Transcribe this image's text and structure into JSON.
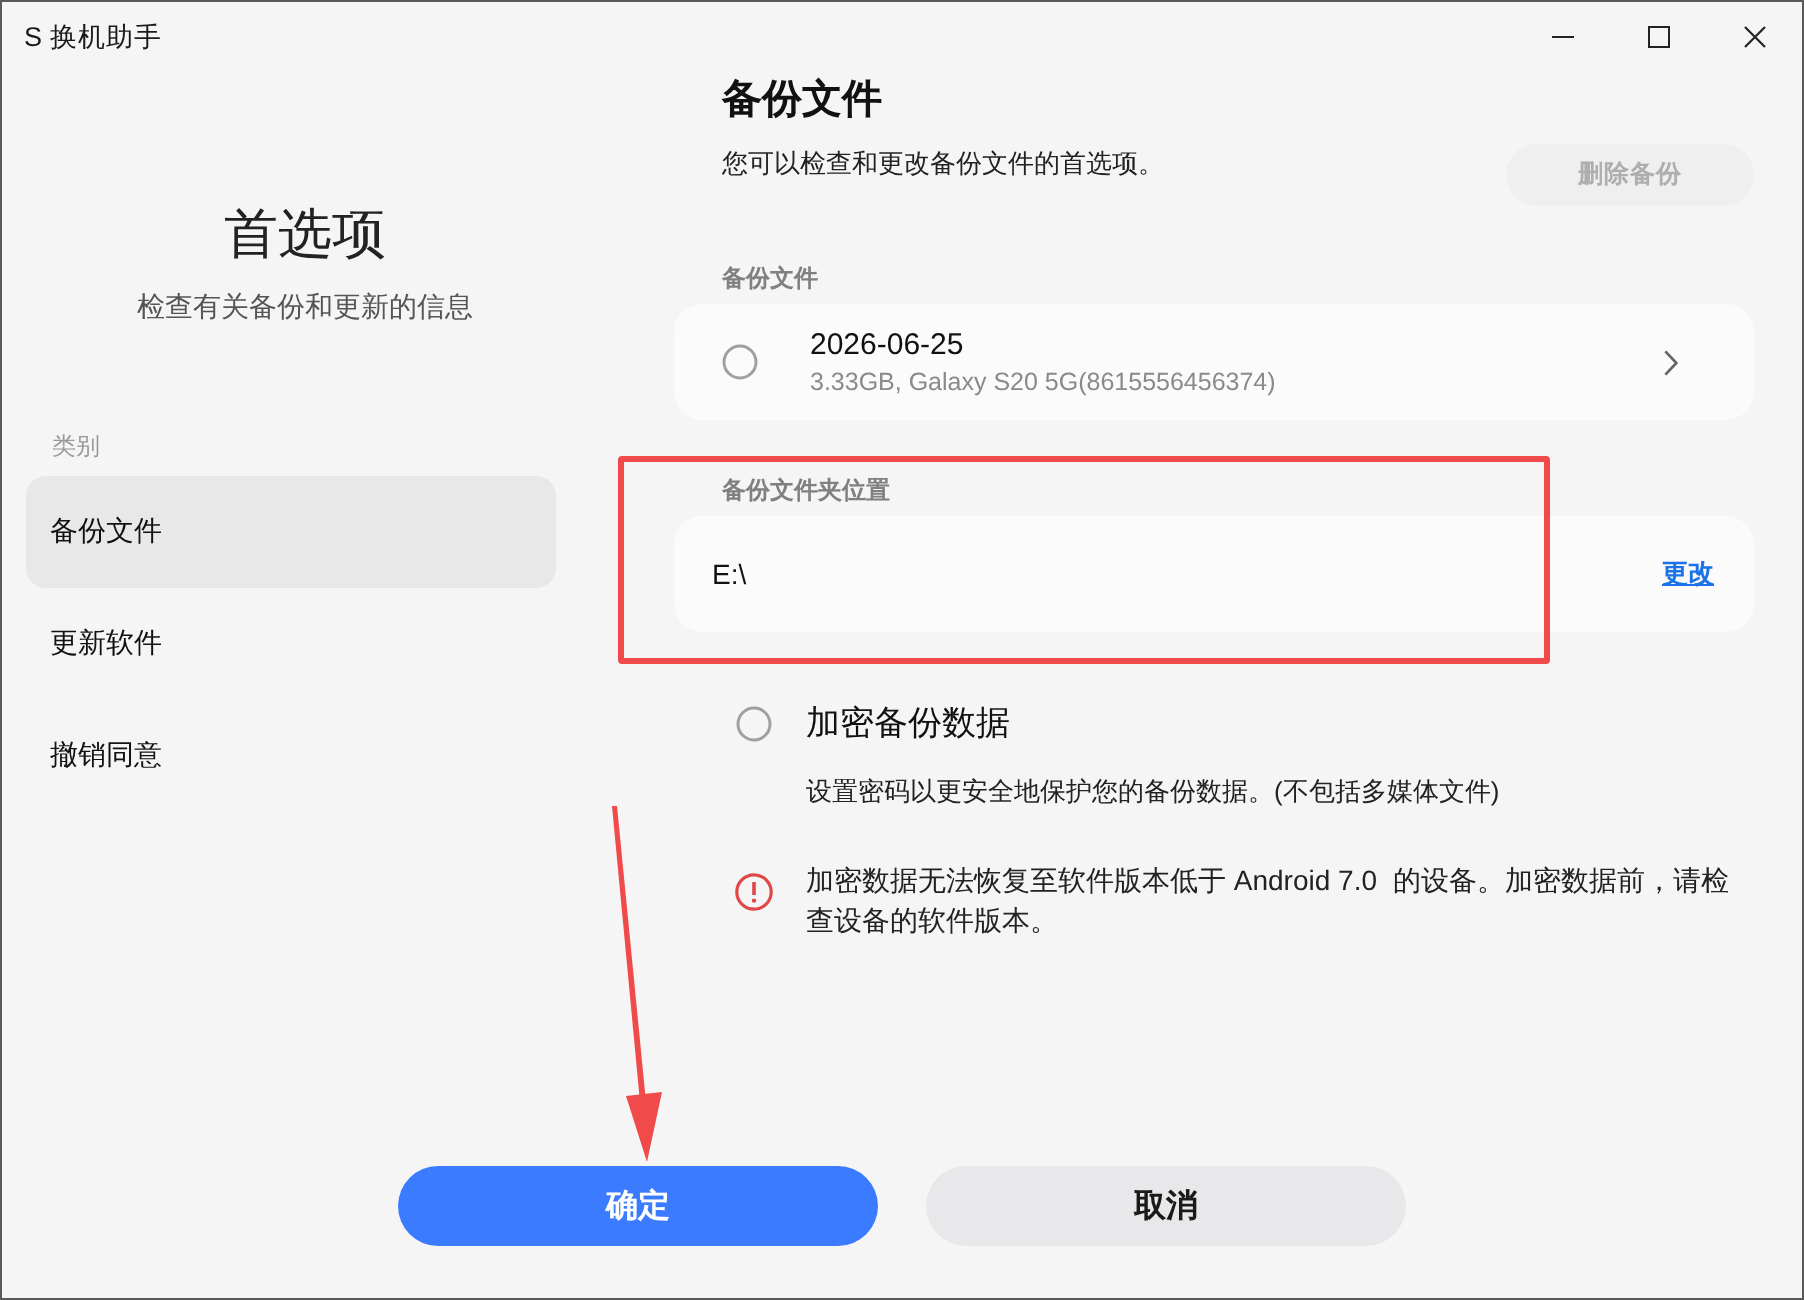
{
  "window": {
    "title": "S 换机助手"
  },
  "sidebar": {
    "title": "首选项",
    "subtitle": "检查有关备份和更新的信息",
    "category_label": "类别",
    "items": [
      {
        "label": "备份文件",
        "selected": true
      },
      {
        "label": "更新软件",
        "selected": false
      },
      {
        "label": "撤销同意",
        "selected": false
      }
    ]
  },
  "content": {
    "title": "备份文件",
    "description": "您可以检查和更改备份文件的首选项。",
    "delete_button": {
      "label": "删除备份",
      "disabled": true
    },
    "backup_section": {
      "label": "备份文件",
      "files": [
        {
          "date": "2026-06-25",
          "details": "3.33GB, Galaxy S20 5G(8615556456374)",
          "selected": false
        }
      ]
    },
    "folder_section": {
      "label": "备份文件夹位置",
      "path": "E:\\",
      "change_link": "更改"
    },
    "encrypt": {
      "label": "加密备份数据",
      "checked": false,
      "description": "设置密码以更安全地保护您的备份数据。(不包括多媒体文件)",
      "warning": "加密数据无法恢复至软件版本低于 Android 7.0  的设备。加密数据前，请检查设备的软件版本。"
    }
  },
  "buttons": [
    {
      "label": "确定",
      "kind": "primary"
    },
    {
      "label": "取消",
      "kind": "secondary"
    }
  ],
  "annotations": [
    {
      "kind": "box"
    },
    {
      "kind": "arrow"
    }
  ]
}
